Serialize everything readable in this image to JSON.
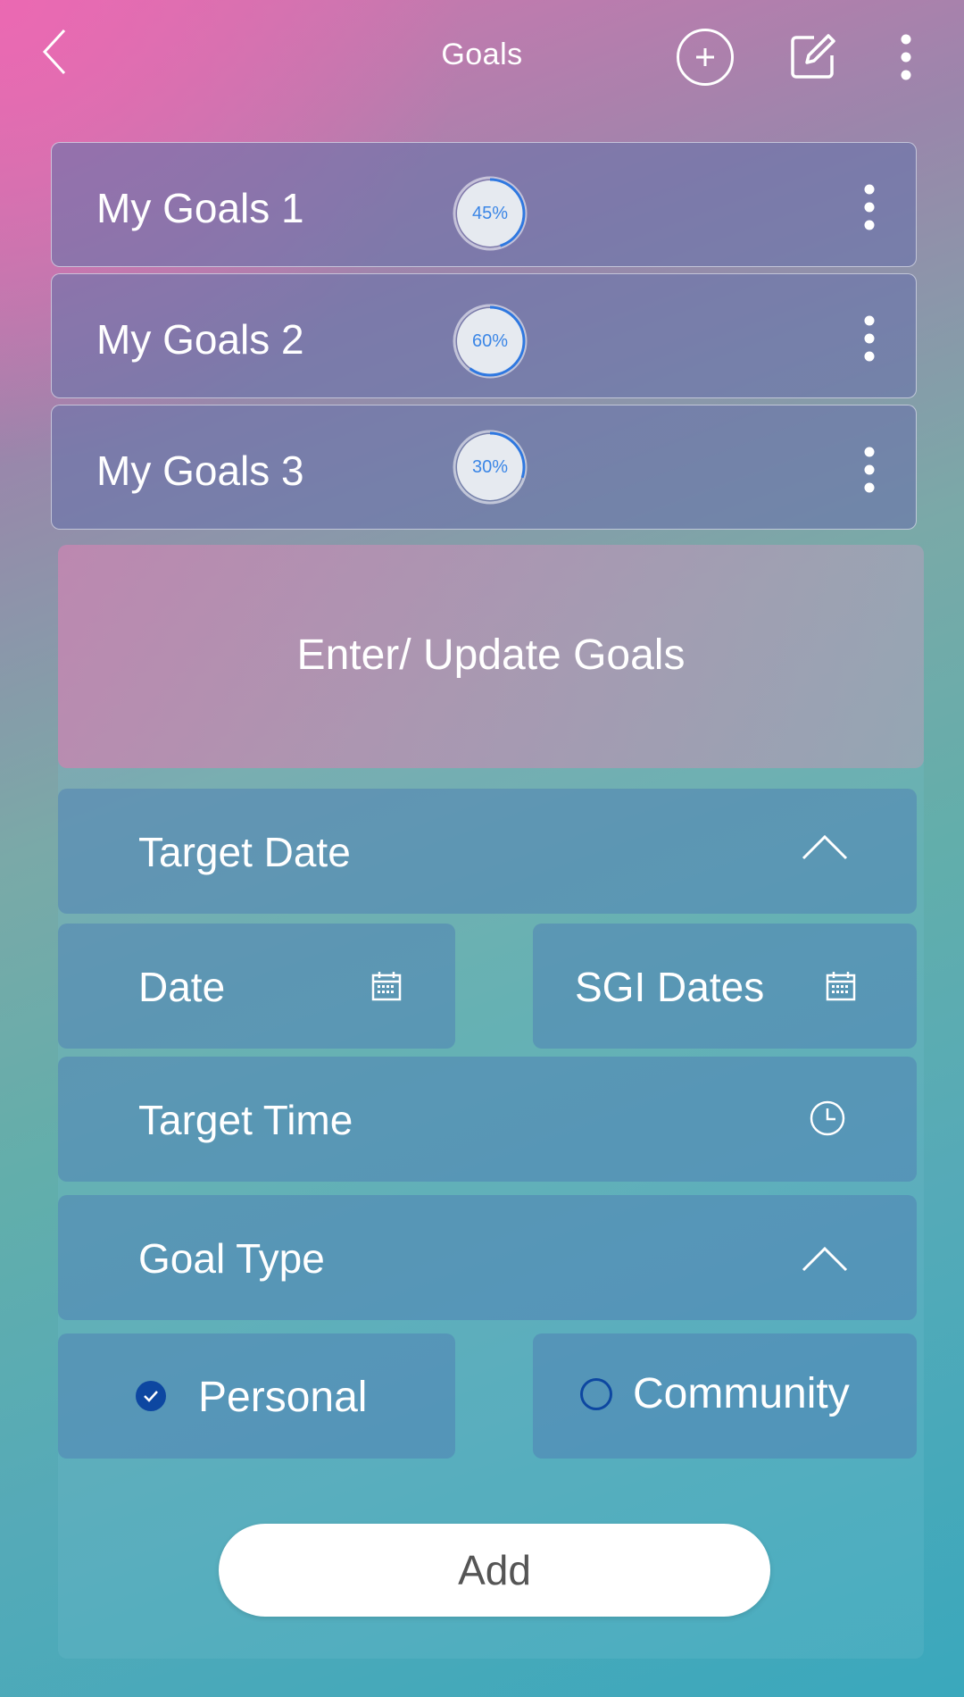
{
  "header": {
    "title": "Goals"
  },
  "goals": [
    {
      "name": "My Goals 1",
      "percent_label": "45%",
      "progress": 0.45
    },
    {
      "name": "My Goals 2",
      "percent_label": "60%",
      "progress": 0.6
    },
    {
      "name": "My Goals 3",
      "percent_label": "30%",
      "progress": 0.3
    }
  ],
  "form": {
    "heading": "Enter/ Update Goals",
    "target_date": {
      "label": "Target Date"
    },
    "date": {
      "label": "Date"
    },
    "sgi_dates": {
      "label": "SGI Dates"
    },
    "target_time": {
      "label": "Target Time"
    },
    "goal_type": {
      "label": "Goal Type"
    },
    "options": [
      {
        "label": "Personal",
        "selected": true
      },
      {
        "label": "Community",
        "selected": false
      }
    ],
    "add_label": "Add"
  },
  "colors": {
    "accent_blue": "#3b86e6",
    "radio_blue": "#0d47a1"
  }
}
